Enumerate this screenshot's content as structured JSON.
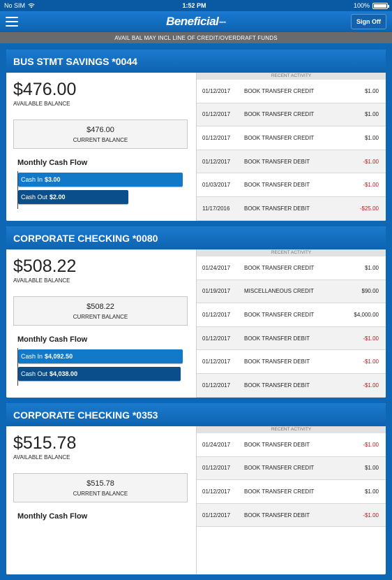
{
  "statusbar": {
    "carrier": "No SIM",
    "time": "1:52 PM",
    "battery": "100%"
  },
  "navbar": {
    "logo": "Beneficial",
    "logo_sub": "BANK",
    "signoff_label": "Sign Off"
  },
  "notice": "AVAIL BAL MAY INCL LINE OF CREDIT/OVERDRAFT FUNDS",
  "labels": {
    "available": "AVAILABLE BALANCE",
    "current": "CURRENT BALANCE",
    "cashflow": "Monthly Cash Flow",
    "cash_in": "Cash In",
    "cash_out": "Cash Out",
    "recent": "RECENT ACTIVITY"
  },
  "accounts": [
    {
      "name": "BUS STMT SAVINGS *0044",
      "available": "$476.00",
      "current": "$476.00",
      "cash_in": "$3.00",
      "cash_out": "$2.00",
      "cash_in_fraction": 1.0,
      "cash_out_fraction": 0.67,
      "activity": [
        {
          "date": "01/12/2017",
          "desc": "BOOK TRANSFER CREDIT",
          "amount": "$1.00",
          "neg": false
        },
        {
          "date": "01/12/2017",
          "desc": "BOOK TRANSFER CREDIT",
          "amount": "$1.00",
          "neg": false
        },
        {
          "date": "01/12/2017",
          "desc": "BOOK TRANSFER CREDIT",
          "amount": "$1.00",
          "neg": false
        },
        {
          "date": "01/12/2017",
          "desc": "BOOK TRANSFER DEBIT",
          "amount": "-$1.00",
          "neg": true
        },
        {
          "date": "01/03/2017",
          "desc": "BOOK TRANSFER DEBIT",
          "amount": "-$1.00",
          "neg": true
        },
        {
          "date": "11/17/2016",
          "desc": "BOOK TRANSFER DEBIT",
          "amount": "-$25.00",
          "neg": true
        }
      ]
    },
    {
      "name": "CORPORATE CHECKING *0080",
      "available": "$508.22",
      "current": "$508.22",
      "cash_in": "$4,092.50",
      "cash_out": "$4,038.00",
      "cash_in_fraction": 1.0,
      "cash_out_fraction": 0.987,
      "activity": [
        {
          "date": "01/24/2017",
          "desc": "BOOK TRANSFER CREDIT",
          "amount": "$1.00",
          "neg": false
        },
        {
          "date": "01/19/2017",
          "desc": "MISCELLANEOUS CREDIT",
          "amount": "$90.00",
          "neg": false
        },
        {
          "date": "01/12/2017",
          "desc": "BOOK TRANSFER CREDIT",
          "amount": "$4,000.00",
          "neg": false
        },
        {
          "date": "01/12/2017",
          "desc": "BOOK TRANSFER DEBIT",
          "amount": "-$1.00",
          "neg": true
        },
        {
          "date": "01/12/2017",
          "desc": "BOOK TRANSFER DEBIT",
          "amount": "-$1.00",
          "neg": true
        },
        {
          "date": "01/12/2017",
          "desc": "BOOK TRANSFER DEBIT",
          "amount": "-$1.00",
          "neg": true
        }
      ]
    },
    {
      "name": "CORPORATE CHECKING *0353",
      "available": "$515.78",
      "current": "$515.78",
      "activity": [
        {
          "date": "01/24/2017",
          "desc": "BOOK TRANSFER DEBIT",
          "amount": "-$1.00",
          "neg": true
        },
        {
          "date": "01/12/2017",
          "desc": "BOOK TRANSFER CREDIT",
          "amount": "$1.00",
          "neg": false
        },
        {
          "date": "01/12/2017",
          "desc": "BOOK TRANSFER CREDIT",
          "amount": "$1.00",
          "neg": false
        },
        {
          "date": "01/12/2017",
          "desc": "BOOK TRANSFER DEBIT",
          "amount": "-$1.00",
          "neg": true
        }
      ]
    }
  ]
}
